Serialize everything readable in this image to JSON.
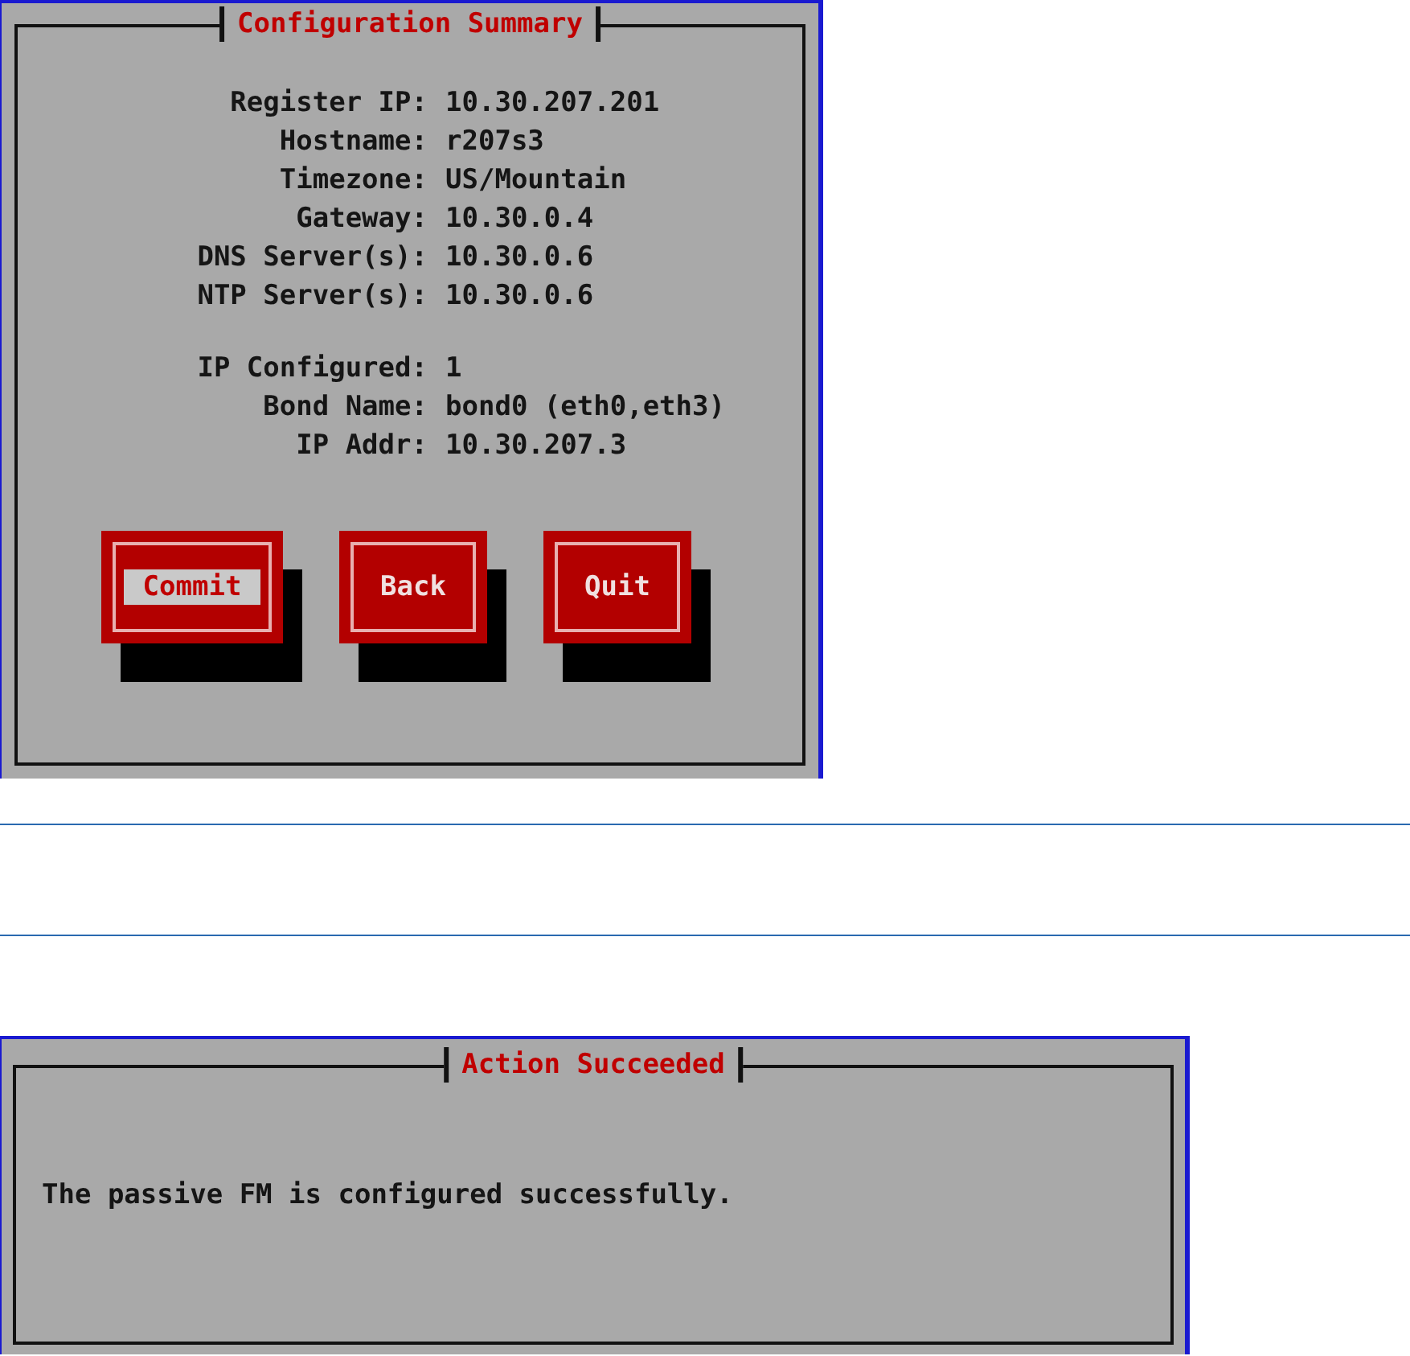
{
  "config_dialog": {
    "title": "Configuration Summary",
    "groups": [
      [
        {
          "label": "Register IP:",
          "value": "10.30.207.201"
        },
        {
          "label": "Hostname:",
          "value": "r207s3"
        },
        {
          "label": "Timezone:",
          "value": "US/Mountain"
        },
        {
          "label": "Gateway:",
          "value": "10.30.0.4"
        },
        {
          "label": "DNS Server(s):",
          "value": "10.30.0.6"
        },
        {
          "label": "NTP Server(s):",
          "value": "10.30.0.6"
        }
      ],
      [
        {
          "label": "IP Configured:",
          "value": "1"
        },
        {
          "label": "Bond Name:",
          "value": "bond0 (eth0,eth3)"
        },
        {
          "label": "IP Addr:",
          "value": "10.30.207.3"
        }
      ]
    ],
    "buttons": [
      {
        "label": "Commit",
        "selected": true
      },
      {
        "label": "Back",
        "selected": false
      },
      {
        "label": "Quit",
        "selected": false
      }
    ]
  },
  "result_dialog": {
    "title": "Action Succeeded",
    "message": "The passive FM is configured successfully."
  }
}
